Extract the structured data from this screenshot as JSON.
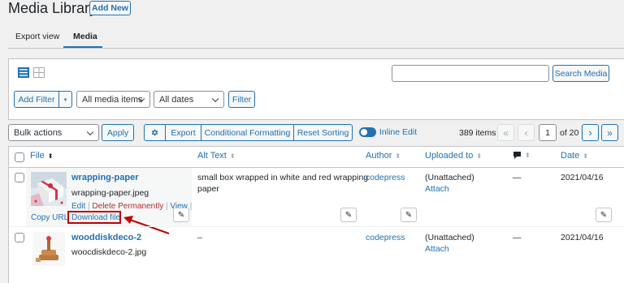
{
  "header": {
    "title": "Media Library",
    "add_new": "Add New"
  },
  "tabs": [
    {
      "label": "Export view"
    },
    {
      "label": "Media",
      "active": true
    }
  ],
  "filters": {
    "add_filter": "Add Filter",
    "media_type": "All media items",
    "dates": "All dates",
    "filter_button": "Filter",
    "search_value": "",
    "search_button": "Search Media"
  },
  "toolbar": {
    "bulk_actions": "Bulk actions",
    "apply": "Apply",
    "export": "Export",
    "conditional_formatting": "Conditional Formatting",
    "reset_sorting": "Reset Sorting",
    "inline_edit": "Inline Edit",
    "items_count": "389 items",
    "first": "«",
    "prev": "‹",
    "page": "1",
    "of_pages": "of 20",
    "next": "›",
    "last": "»"
  },
  "columns": {
    "file": "File",
    "alt_text": "Alt Text",
    "author": "Author",
    "uploaded_to": "Uploaded to",
    "date": "Date"
  },
  "rows": [
    {
      "title": "wrapping-paper",
      "filename": "wrapping-paper.jpeg",
      "actions": {
        "edit": "Edit",
        "sep1": "|",
        "delete": "Delete Permanently",
        "sep2": "|",
        "view": "View",
        "sep3": "|",
        "copy_url": "Copy URL",
        "download": "Download file"
      },
      "alt_text": "small box wrapped in white and red wrapping paper",
      "alt_text_line1": "small box wrapped in white and red wrapping",
      "alt_text_line2": "paper",
      "author": "codepress",
      "uploaded_to": "(Unattached)",
      "attach": "Attach",
      "comments": "—",
      "date": "2021/04/16"
    },
    {
      "title": "wooddiskdeco-2",
      "filename": "woocdiskdeco-2.jpg",
      "alt_text": "–",
      "author": "codepress",
      "uploaded_to": "(Unattached)",
      "attach": "Attach",
      "comments": "—",
      "date": "2021/04/16"
    }
  ],
  "colors": {
    "accent": "#2271b1",
    "highlight": "#c00000",
    "background": "#f0f0f1"
  }
}
